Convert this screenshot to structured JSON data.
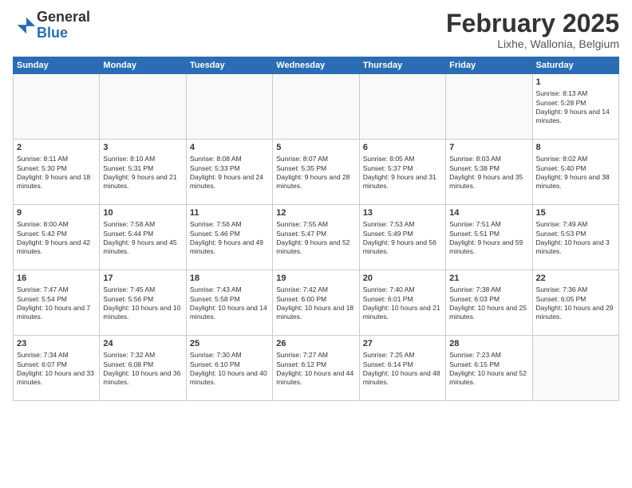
{
  "header": {
    "logo_general": "General",
    "logo_blue": "Blue",
    "title": "February 2025",
    "location": "Lixhe, Wallonia, Belgium"
  },
  "days_of_week": [
    "Sunday",
    "Monday",
    "Tuesday",
    "Wednesday",
    "Thursday",
    "Friday",
    "Saturday"
  ],
  "weeks": [
    [
      {
        "day": "",
        "info": ""
      },
      {
        "day": "",
        "info": ""
      },
      {
        "day": "",
        "info": ""
      },
      {
        "day": "",
        "info": ""
      },
      {
        "day": "",
        "info": ""
      },
      {
        "day": "",
        "info": ""
      },
      {
        "day": "1",
        "info": "Sunrise: 8:13 AM\nSunset: 5:28 PM\nDaylight: 9 hours and 14 minutes."
      }
    ],
    [
      {
        "day": "2",
        "info": "Sunrise: 8:11 AM\nSunset: 5:30 PM\nDaylight: 9 hours and 18 minutes."
      },
      {
        "day": "3",
        "info": "Sunrise: 8:10 AM\nSunset: 5:31 PM\nDaylight: 9 hours and 21 minutes."
      },
      {
        "day": "4",
        "info": "Sunrise: 8:08 AM\nSunset: 5:33 PM\nDaylight: 9 hours and 24 minutes."
      },
      {
        "day": "5",
        "info": "Sunrise: 8:07 AM\nSunset: 5:35 PM\nDaylight: 9 hours and 28 minutes."
      },
      {
        "day": "6",
        "info": "Sunrise: 8:05 AM\nSunset: 5:37 PM\nDaylight: 9 hours and 31 minutes."
      },
      {
        "day": "7",
        "info": "Sunrise: 8:03 AM\nSunset: 5:38 PM\nDaylight: 9 hours and 35 minutes."
      },
      {
        "day": "8",
        "info": "Sunrise: 8:02 AM\nSunset: 5:40 PM\nDaylight: 9 hours and 38 minutes."
      }
    ],
    [
      {
        "day": "9",
        "info": "Sunrise: 8:00 AM\nSunset: 5:42 PM\nDaylight: 9 hours and 42 minutes."
      },
      {
        "day": "10",
        "info": "Sunrise: 7:58 AM\nSunset: 5:44 PM\nDaylight: 9 hours and 45 minutes."
      },
      {
        "day": "11",
        "info": "Sunrise: 7:56 AM\nSunset: 5:46 PM\nDaylight: 9 hours and 49 minutes."
      },
      {
        "day": "12",
        "info": "Sunrise: 7:55 AM\nSunset: 5:47 PM\nDaylight: 9 hours and 52 minutes."
      },
      {
        "day": "13",
        "info": "Sunrise: 7:53 AM\nSunset: 5:49 PM\nDaylight: 9 hours and 56 minutes."
      },
      {
        "day": "14",
        "info": "Sunrise: 7:51 AM\nSunset: 5:51 PM\nDaylight: 9 hours and 59 minutes."
      },
      {
        "day": "15",
        "info": "Sunrise: 7:49 AM\nSunset: 5:53 PM\nDaylight: 10 hours and 3 minutes."
      }
    ],
    [
      {
        "day": "16",
        "info": "Sunrise: 7:47 AM\nSunset: 5:54 PM\nDaylight: 10 hours and 7 minutes."
      },
      {
        "day": "17",
        "info": "Sunrise: 7:45 AM\nSunset: 5:56 PM\nDaylight: 10 hours and 10 minutes."
      },
      {
        "day": "18",
        "info": "Sunrise: 7:43 AM\nSunset: 5:58 PM\nDaylight: 10 hours and 14 minutes."
      },
      {
        "day": "19",
        "info": "Sunrise: 7:42 AM\nSunset: 6:00 PM\nDaylight: 10 hours and 18 minutes."
      },
      {
        "day": "20",
        "info": "Sunrise: 7:40 AM\nSunset: 6:01 PM\nDaylight: 10 hours and 21 minutes."
      },
      {
        "day": "21",
        "info": "Sunrise: 7:38 AM\nSunset: 6:03 PM\nDaylight: 10 hours and 25 minutes."
      },
      {
        "day": "22",
        "info": "Sunrise: 7:36 AM\nSunset: 6:05 PM\nDaylight: 10 hours and 29 minutes."
      }
    ],
    [
      {
        "day": "23",
        "info": "Sunrise: 7:34 AM\nSunset: 6:07 PM\nDaylight: 10 hours and 33 minutes."
      },
      {
        "day": "24",
        "info": "Sunrise: 7:32 AM\nSunset: 6:08 PM\nDaylight: 10 hours and 36 minutes."
      },
      {
        "day": "25",
        "info": "Sunrise: 7:30 AM\nSunset: 6:10 PM\nDaylight: 10 hours and 40 minutes."
      },
      {
        "day": "26",
        "info": "Sunrise: 7:27 AM\nSunset: 6:12 PM\nDaylight: 10 hours and 44 minutes."
      },
      {
        "day": "27",
        "info": "Sunrise: 7:25 AM\nSunset: 6:14 PM\nDaylight: 10 hours and 48 minutes."
      },
      {
        "day": "28",
        "info": "Sunrise: 7:23 AM\nSunset: 6:15 PM\nDaylight: 10 hours and 52 minutes."
      },
      {
        "day": "",
        "info": ""
      }
    ]
  ]
}
